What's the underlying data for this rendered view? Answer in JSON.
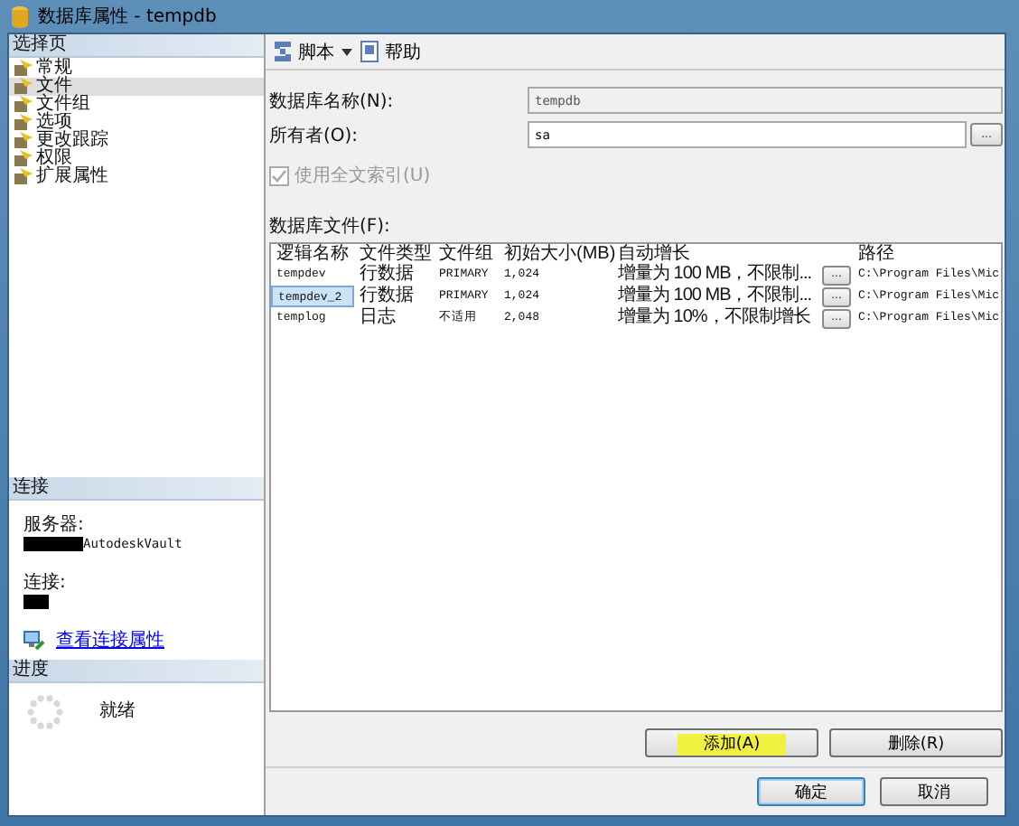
{
  "window": {
    "title": "数据库属性 - tempdb"
  },
  "sidebar": {
    "header": "选择页",
    "items": [
      {
        "label": "常规",
        "selected": false
      },
      {
        "label": "文件",
        "selected": true
      },
      {
        "label": "文件组",
        "selected": false
      },
      {
        "label": "选项",
        "selected": false
      },
      {
        "label": "更改跟踪",
        "selected": false
      },
      {
        "label": "权限",
        "selected": false
      },
      {
        "label": "扩展属性",
        "selected": false
      }
    ]
  },
  "connection": {
    "header": "连接",
    "server_label": "服务器:",
    "server_value": "AutodeskVault",
    "connection_label": "连接:",
    "link": "查看连接属性"
  },
  "progress": {
    "header": "进度",
    "status": "就绪"
  },
  "toolbar": {
    "script": "脚本",
    "help": "帮助"
  },
  "form": {
    "db_name_label": "数据库名称(N):",
    "db_name_value": "tempdb",
    "owner_label": "所有者(O):",
    "owner_value": "sa",
    "browse": "...",
    "fulltext_label": "使用全文索引(U)",
    "fulltext_checked": true,
    "fulltext_disabled": true,
    "files_label": "数据库文件(F):"
  },
  "table": {
    "columns": [
      "逻辑名称",
      "文件类型",
      "文件组",
      "初始大小(MB)",
      "自动增长",
      "路径"
    ],
    "rows": [
      {
        "cells": [
          "tempdev",
          "行数据",
          "PRIMARY",
          "1,024",
          "增量为 100 MB，不限制...",
          "C:\\Program Files\\Mic"
        ],
        "selected": false,
        "button": "..."
      },
      {
        "cells": [
          "tempdev_2",
          "行数据",
          "PRIMARY",
          "1,024",
          "增量为 100 MB，不限制...",
          "C:\\Program Files\\Mic"
        ],
        "selected": true,
        "button": "..."
      },
      {
        "cells": [
          "templog",
          "日志",
          "不适用",
          "2,048",
          "增量为 10%，不限制增长",
          "C:\\Program Files\\Mic"
        ],
        "selected": false,
        "button": "..."
      }
    ]
  },
  "actions": [
    {
      "label": "添加(A)",
      "highlighted": true
    },
    {
      "label": "删除(R)",
      "highlighted": false
    }
  ],
  "buttons": [
    {
      "label": "确定",
      "default": true
    },
    {
      "label": "取消",
      "default": false
    }
  ]
}
